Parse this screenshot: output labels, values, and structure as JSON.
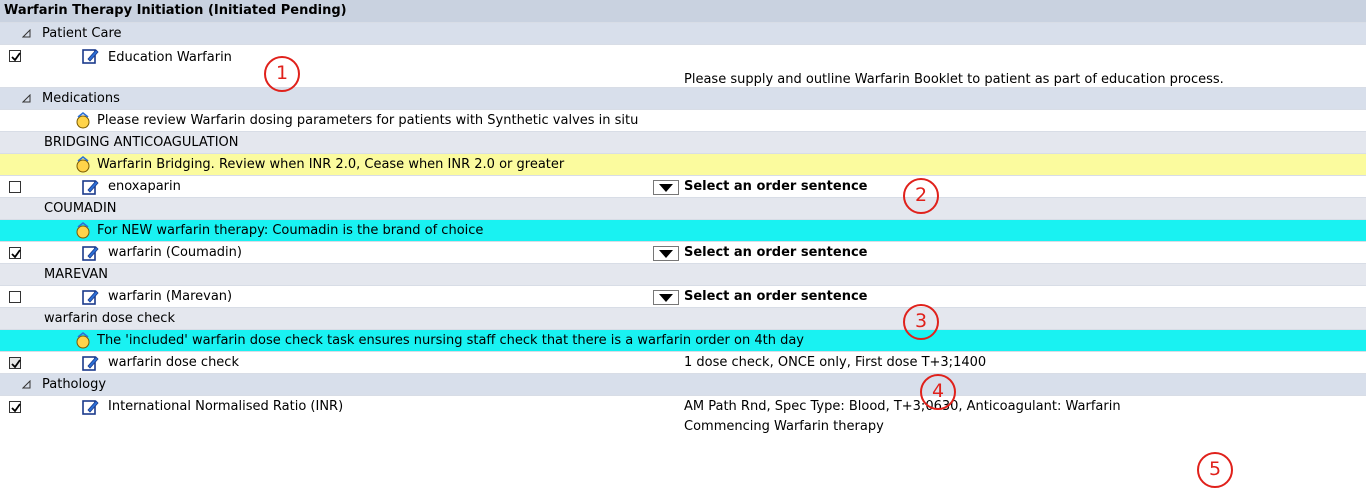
{
  "title": "Warfarin Therapy Initiation (Initiated Pending)",
  "sections": {
    "patient_care": "Patient Care",
    "medications": "Medications",
    "pathology": "Pathology"
  },
  "subsections": {
    "bridging": "BRIDGING ANTICOAGULATION",
    "coumadin": "COUMADIN",
    "marevan": "MAREVAN",
    "dose_check": "warfarin dose check"
  },
  "items": {
    "education": {
      "label": "Education Warfarin",
      "detail": "Please supply and outline Warfarin Booklet to patient as part of education process.",
      "checked": true
    },
    "enoxaparin": {
      "label": "enoxaparin",
      "detail": "Select an order sentence",
      "checked": false
    },
    "coumadin": {
      "label": "warfarin (Coumadin)",
      "detail": "Select an order sentence",
      "checked": true
    },
    "marevan": {
      "label": "warfarin (Marevan)",
      "detail": "Select an order sentence",
      "checked": false
    },
    "dose_check": {
      "label": "warfarin dose check",
      "detail": "1 dose check, ONCE only, First dose T+3;1400",
      "checked": true
    },
    "inr": {
      "label": "International Normalised Ratio (INR)",
      "detail_1": "AM Path Rnd, Spec Type: Blood, T+3;0630, Anticoagulant: Warfarin",
      "detail_2": "Commencing Warfarin therapy",
      "checked": true
    }
  },
  "notes": {
    "synthetic": "Please review Warfarin dosing parameters for patients with Synthetic valves in situ",
    "bridging": "Warfarin Bridging. Review when INR 2.0, Cease when INR 2.0 or greater",
    "coumadin": "For NEW warfarin therapy: Coumadin is the brand of choice",
    "dose_check": "The 'included' warfarin dose check task ensures nursing staff check that there is a warfarin order on 4th day"
  },
  "callouts": [
    "1",
    "2",
    "3",
    "4",
    "5"
  ],
  "colors": {
    "yellow_note": "#fbfb9e",
    "cyan_note": "#19f2f2",
    "callout": "#e0211b"
  }
}
